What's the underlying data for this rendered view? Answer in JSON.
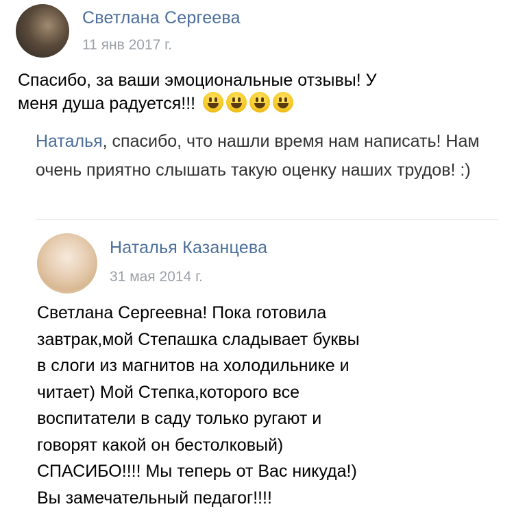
{
  "comment": {
    "author": "Светлана Сергеева",
    "date": "11 янв 2017 г.",
    "message": "Спасибо, за ваши эмоциональные отзывы! У",
    "message_line2": "меня душа радуется!!!",
    "emoji_icons": [
      "grinning-face-icon",
      "grinning-face-icon",
      "grinning-face-icon",
      "grinning-face-icon"
    ]
  },
  "reply": {
    "mention": "Наталья",
    "text": ", спасибо, что нашли время нам написать! Нам очень приятно слышать такую оценку наших трудов! :)"
  },
  "quoted_review": {
    "author": "Наталья Казанцева",
    "date": "31 мая 2014 г.",
    "lines": [
      "Светлана Сергеевна! Пока готовила",
      "завтрак,мой Степашка сладывает буквы",
      "в слоги из магнитов на холодильнике и",
      "читает) Мой Степка,которого все",
      "воспитатели в саду только ругают и",
      "говорят какой он бестолковый)",
      "СПАСИБО!!!! Мы теперь от Вас никуда!)",
      "Вы замечательный педагог!!!!"
    ]
  },
  "colors": {
    "name_link": "#4b6e9b",
    "date_gray": "#9aa0a6",
    "emoji": "#f5c824"
  }
}
